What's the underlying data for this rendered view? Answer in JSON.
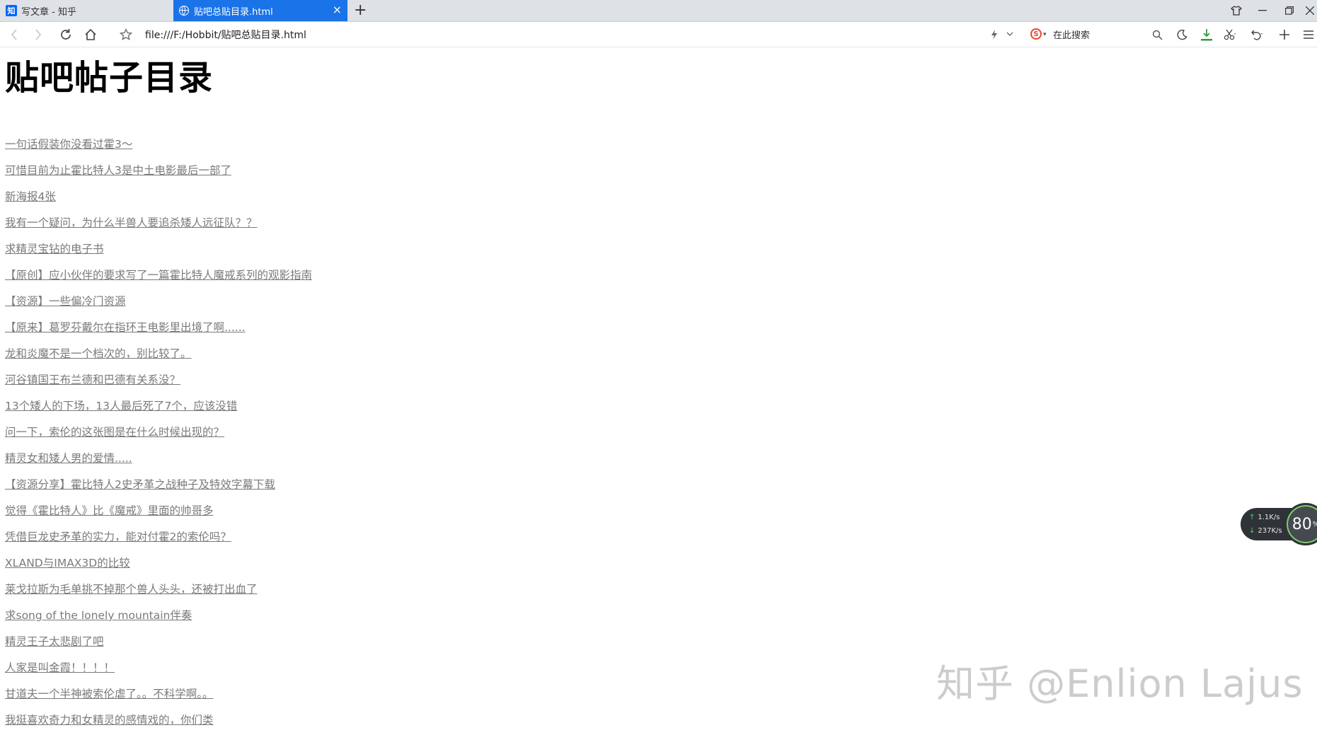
{
  "tabs": [
    {
      "label": "写文章 - 知乎",
      "active": false
    },
    {
      "label": "贴吧总贴目录.html",
      "active": true
    }
  ],
  "address_bar": {
    "url": "file:///F:/Hobbit/贴吧总贴目录.html"
  },
  "search": {
    "placeholder": "在此搜索"
  },
  "page": {
    "title": "贴吧帖子目录",
    "posts": [
      "一句话假装你没看过霍3～",
      "可惜目前为止霍比特人3是中土电影最后一部了",
      "新海报4张",
      "我有一个疑问，为什么半兽人要追杀矮人远征队？？",
      "求精灵宝钻的电子书",
      "【原创】应小伙伴的要求写了一篇霍比特人魔戒系列的观影指南",
      "【资源】一些偏冷门资源",
      "【原来】葛罗芬戴尔在指环王电影里出境了啊......",
      "龙和炎魔不是一个档次的，别比较了。",
      "河谷镇国王布兰德和巴德有关系没？",
      "13个矮人的下场，13人最后死了7个，应该没错",
      "问一下，索伦的这张图是在什么时候出现的？",
      "精灵女和矮人男的爱情.....",
      "【资源分享】霍比特人2史矛革之战种子及特效字幕下载",
      "觉得《霍比特人》比《魔戒》里面的帅哥多",
      "凭借巨龙史矛革的实力，能对付霍2的索伦吗？",
      "XLAND与IMAX3D的比较",
      "莱戈拉斯为毛单挑不掉那个兽人头头，还被打出血了",
      "求song of the lonely mountain伴奏",
      "精灵王子太悲剧了吧",
      "人家是叫金霞！！！！",
      "甘道夫一个半神被索伦虐了。。不科学啊。。",
      "我挺喜欢奇力和女精灵的感情戏的，你们类"
    ]
  },
  "speed_widget": {
    "upload": "1.1K/s",
    "download": "237K/s",
    "percent": "80",
    "percent_unit": "%"
  },
  "watermark": {
    "text": "知乎 @Enlion Lajus"
  },
  "icons": {
    "zhihu_favicon": "知",
    "sogou": "S"
  },
  "colors": {
    "active_tab": "#1a73e8",
    "link": "#7a7a7a",
    "zhihu_blue": "#0066ff"
  }
}
